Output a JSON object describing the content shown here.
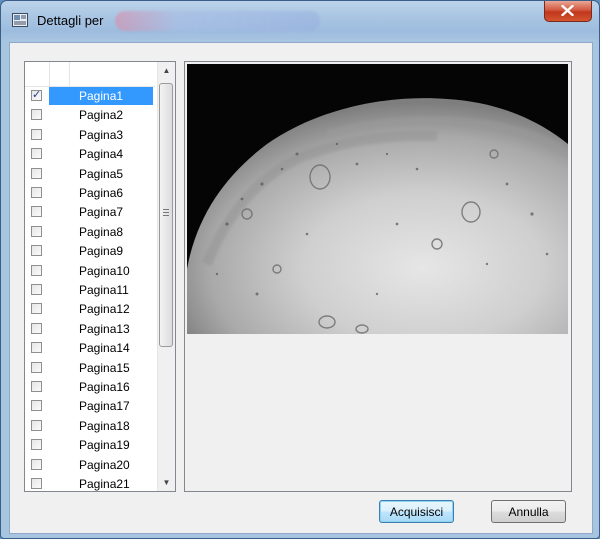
{
  "window": {
    "title": "Dettagli per",
    "close_glyph": "close-icon"
  },
  "pages": {
    "header": "",
    "items": [
      {
        "label": "Pagina1",
        "checked": true,
        "selected": true
      },
      {
        "label": "Pagina2",
        "checked": false
      },
      {
        "label": "Pagina3",
        "checked": false
      },
      {
        "label": "Pagina4",
        "checked": false
      },
      {
        "label": "Pagina5",
        "checked": false
      },
      {
        "label": "Pagina6",
        "checked": false
      },
      {
        "label": "Pagina7",
        "checked": false
      },
      {
        "label": "Pagina8",
        "checked": false
      },
      {
        "label": "Pagina9",
        "checked": false
      },
      {
        "label": "Pagina10",
        "checked": false
      },
      {
        "label": "Pagina11",
        "checked": false
      },
      {
        "label": "Pagina12",
        "checked": false
      },
      {
        "label": "Pagina13",
        "checked": false
      },
      {
        "label": "Pagina14",
        "checked": false
      },
      {
        "label": "Pagina15",
        "checked": false
      },
      {
        "label": "Pagina16",
        "checked": false
      },
      {
        "label": "Pagina17",
        "checked": false
      },
      {
        "label": "Pagina18",
        "checked": false
      },
      {
        "label": "Pagina19",
        "checked": false
      },
      {
        "label": "Pagina20",
        "checked": false
      },
      {
        "label": "Pagina21",
        "checked": false
      }
    ]
  },
  "buttons": {
    "acquire": "Acquisisci",
    "cancel": "Annulla"
  },
  "colors": {
    "selection": "#3399ff",
    "close_button": "#c1371d"
  }
}
